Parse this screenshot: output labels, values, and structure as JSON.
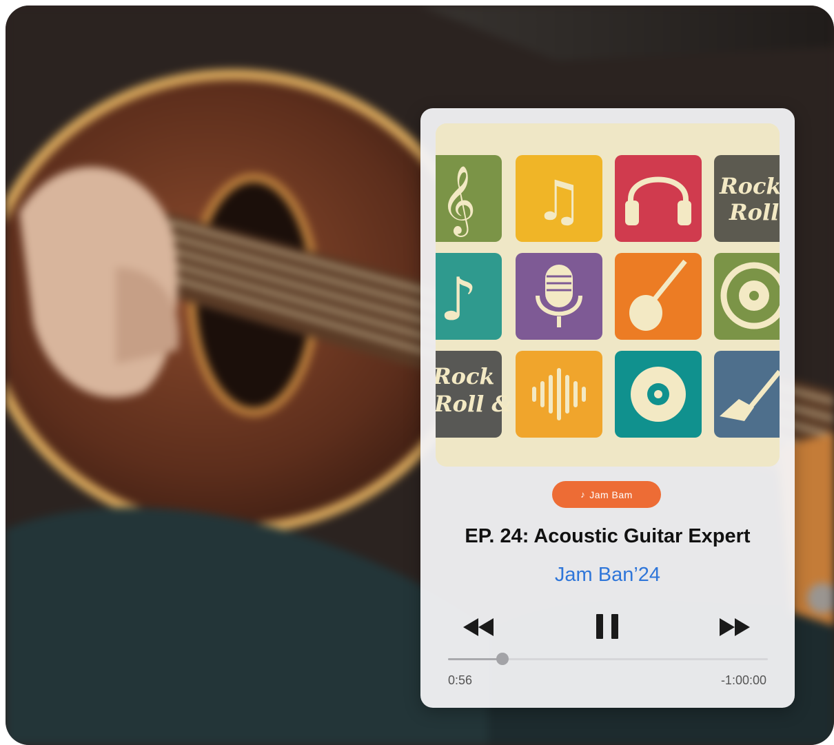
{
  "player": {
    "tag_icon": "music-note-icon",
    "tag_label": "Jam Bam",
    "title": "EP. 24: Acoustic Guitar Expert",
    "subtitle": "Jam Ban’24",
    "controls": {
      "rewind_icon": "rewind-icon",
      "pause_icon": "pause-icon",
      "forward_icon": "fast-forward-icon"
    },
    "progress_fraction": 0.17,
    "elapsed": "0:56",
    "remaining": "-1:00:00"
  },
  "artwork": {
    "tiles": [
      {
        "icon": "treble-clef-icon",
        "color": "#7b9447"
      },
      {
        "icon": "music-notes-icon",
        "color": "#f0b527"
      },
      {
        "icon": "headphones-icon",
        "color": "#d03b4e"
      },
      {
        "icon": "rock-and-roll-text-icon",
        "text": "Rock Roll &",
        "color": "#5c5a50"
      },
      {
        "icon": "eighth-note-icon",
        "color": "#2f9a8e"
      },
      {
        "icon": "microphone-icon",
        "color": "#7e5a95"
      },
      {
        "icon": "electric-guitar-icon",
        "color": "#ec7c24"
      },
      {
        "icon": "cd-note-icon",
        "color": "#7b9447"
      },
      {
        "icon": "rock-and-roll-text-icon",
        "text": "Rock Roll &",
        "color": "#585855"
      },
      {
        "icon": "sound-wave-icon",
        "color": "#f0a52c"
      },
      {
        "icon": "vinyl-record-icon",
        "color": "#10918e"
      },
      {
        "icon": "guitar-icon",
        "color": "#4e6f8c"
      }
    ]
  },
  "colors": {
    "accent": "#ed6c35",
    "subtitle": "#2f76d9",
    "title": "#111111"
  }
}
